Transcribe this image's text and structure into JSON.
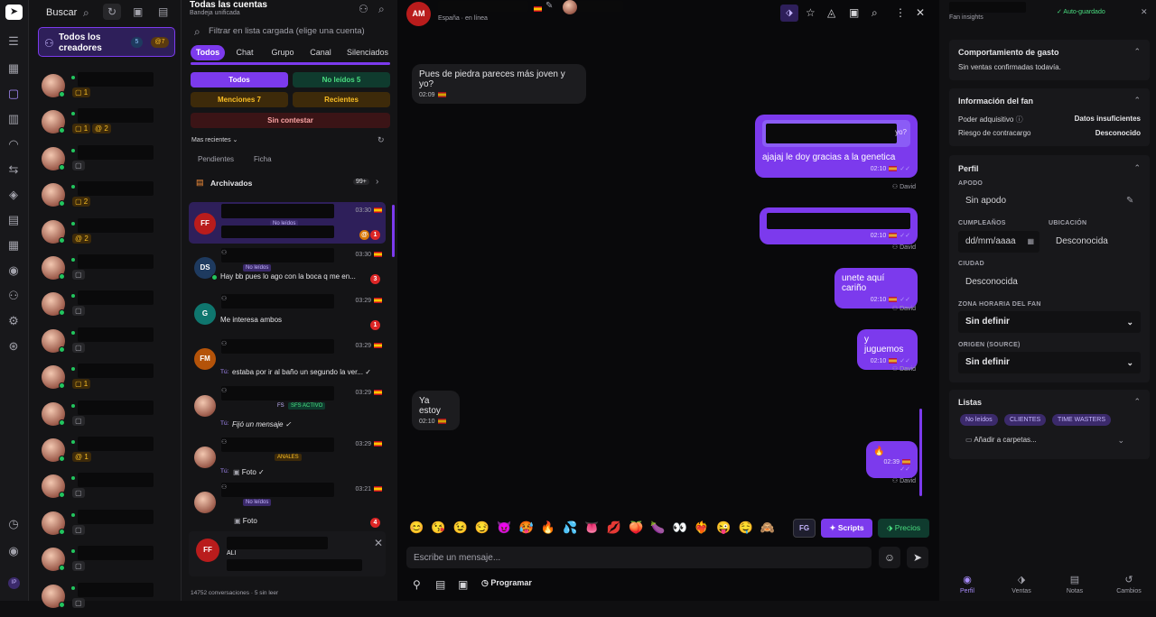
{
  "nav": {
    "icons": [
      "send-logo",
      "menu-icon",
      "grid-icon",
      "chat-icon",
      "chart-icon",
      "gauge-icon",
      "transfer-icon",
      "shapes-icon",
      "archive-icon",
      "calendar-icon",
      "user-circle-icon",
      "users-icon",
      "settings-icon",
      "support-icon",
      "clock-icon",
      "eye-icon"
    ],
    "avatar_initials": "IP"
  },
  "creators": {
    "search_label": "Buscar",
    "all_label": "Todos los creadores",
    "all_count": "5",
    "all_mentions": "7",
    "rows": [
      {
        "badge": "1",
        "mention": ""
      },
      {
        "badge": "1",
        "mention": "2"
      },
      {
        "badge": "",
        "mention": ""
      },
      {
        "badge": "2",
        "mention": ""
      },
      {
        "badge": "",
        "mention": "2"
      },
      {
        "badge": "",
        "mention": ""
      },
      {
        "badge": "",
        "mention": ""
      },
      {
        "badge": "",
        "mention": ""
      },
      {
        "badge": "1",
        "mention": ""
      },
      {
        "badge": "",
        "mention": ""
      },
      {
        "badge": "",
        "mention": "1"
      },
      {
        "badge": "",
        "mention": ""
      },
      {
        "badge": "",
        "mention": ""
      },
      {
        "badge": "",
        "mention": ""
      },
      {
        "badge": "",
        "mention": ""
      }
    ]
  },
  "convlist": {
    "title": "Todas las cuentas",
    "subtitle": "Bandeja unificada",
    "filter_placeholder": "Filtrar en lista cargada (elige una cuenta)",
    "tabs": [
      "Todos",
      "Chat",
      "Grupo",
      "Canal",
      "Silenciados"
    ],
    "btn_all": "Todos",
    "btn_unread": "No leídos 5",
    "btn_mentions": "Menciones 7",
    "btn_recent": "Recientes",
    "btn_unanswered": "Sin contestar",
    "sort_label": "Mas recientes",
    "pending": "Pendientes",
    "ficha": "Ficha",
    "archived": "Archivados",
    "archived_count": "99+",
    "footer": "14752 conversaciones · 5 sin leer",
    "items": [
      {
        "initials": "FF",
        "time": "03:30",
        "tag": "No leídos",
        "msg": "",
        "badge": "1"
      },
      {
        "initials": "DS",
        "time": "03:30",
        "tag": "No leídos",
        "msg": "Hay bb pues lo ago con la boca q me en...",
        "badge": "3"
      },
      {
        "initials": "G",
        "time": "03:29",
        "tag": "",
        "msg": "Me interesa ambos",
        "badge": "1"
      },
      {
        "initials": "FM",
        "time": "03:29",
        "tag": "",
        "msg": "estaba por ir al baño un segundo la ver... ✓",
        "prefix": "Tú:",
        "badge": ""
      },
      {
        "initials": "",
        "time": "03:29",
        "tag": "SFS ACTIVO",
        "tag0": "FS",
        "msg": "Fijó un mensaje ✓",
        "prefix": "Tú:",
        "badge": ""
      },
      {
        "initials": "",
        "time": "03:29",
        "tag": "ANALES",
        "msg": "Foto ✓",
        "prefix": "Tú:",
        "badge": ""
      },
      {
        "initials": "",
        "time": "03:21",
        "tag": "No leídos",
        "msg": "Foto",
        "badge": "4"
      }
    ],
    "draft": {
      "initials": "FF",
      "text": "ALI"
    }
  },
  "chat": {
    "initials": "AM",
    "status": "España · en línea",
    "messages": [
      {
        "dir": "in",
        "text": "Pues de piedra pareces más joven y yo?",
        "time": "02:09"
      },
      {
        "dir": "out",
        "quote_tail": "yo?",
        "text": "ajajaj le doy gracias a la genetica",
        "time": "02:10",
        "sender": "David"
      },
      {
        "dir": "out",
        "text": "",
        "time": "02:10",
        "sender": "David"
      },
      {
        "dir": "out",
        "text": "unete aquí cariño",
        "time": "02:10",
        "sender": "David"
      },
      {
        "dir": "out",
        "text": "y juguemos",
        "time": "02:10",
        "sender": "David"
      },
      {
        "dir": "in",
        "text": "Ya estoy",
        "time": "02:10"
      },
      {
        "dir": "out",
        "text": "🔥",
        "time": "02:39",
        "sender": "David"
      }
    ],
    "emojis": [
      "😊",
      "😘",
      "😉",
      "😏",
      "😈",
      "🥵",
      "🔥",
      "💦",
      "👅",
      "💋",
      "🍑",
      "🍆",
      "👀",
      "❤️‍🔥",
      "😜",
      "🤤",
      "🙈"
    ],
    "fg_label": "FG",
    "scripts_label": "Scripts",
    "prices_label": "Precios",
    "input_placeholder": "Escribe un mensaje...",
    "schedule_label": "Programar"
  },
  "right": {
    "header_sub": "Fan insights",
    "autosave": "✓ Auto-guardado",
    "spend_title": "Comportamiento de gasto",
    "spend_text": "Sin ventas confirmadas todavía.",
    "info_title": "Información del fan",
    "power_label": "Poder adquisitivo",
    "power_value": "Datos insuficientes",
    "risk_label": "Riesgo de contracargo",
    "risk_value": "Desconocido",
    "profile_title": "Perfil",
    "nick_label": "APODO",
    "nick_value": "Sin apodo",
    "bday_label": "CUMPLEAÑOS",
    "bday_value": "dd/mm/aaaa",
    "loc_label": "UBICACIÓN",
    "loc_value": "Desconocida",
    "city_label": "CIUDAD",
    "city_value": "Desconocida",
    "tz_label": "ZONA HORARIA DEL FAN",
    "tz_value": "Sin definir",
    "origin_label": "ORIGEN (SOURCE)",
    "origin_value": "Sin definir",
    "lists_title": "Listas",
    "tags": [
      "No leídos",
      "CLIENTES",
      "TIME WASTERS"
    ],
    "folders": "Añadir a carpetas...",
    "tabs": [
      "Perfil",
      "Ventas",
      "Notas",
      "Cambios"
    ]
  },
  "colors": {
    "accent": "#7c3aed",
    "green": "#22c55e",
    "red": "#dc2626",
    "amber": "#d97706"
  }
}
